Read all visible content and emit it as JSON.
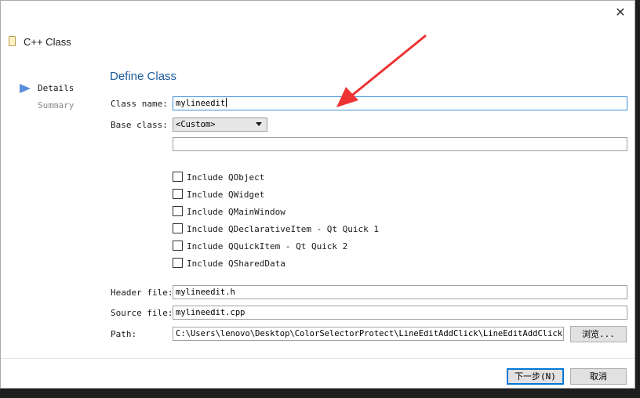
{
  "window": {
    "close_glyph": "✕"
  },
  "wizard": {
    "title": "C++ Class",
    "icon": "document-icon"
  },
  "steps": [
    {
      "label": "Details",
      "active": true
    },
    {
      "label": "Summary",
      "active": false
    }
  ],
  "page": {
    "title": "Define Class"
  },
  "form": {
    "class_name_label": "Class name:",
    "class_name_value": "mylineedit",
    "base_class_label": "Base class:",
    "base_class_value": "<Custom>",
    "custom_base_value": "",
    "checkboxes": [
      {
        "label": "Include QObject",
        "checked": false
      },
      {
        "label": "Include QWidget",
        "checked": false
      },
      {
        "label": "Include QMainWindow",
        "checked": false
      },
      {
        "label": "Include QDeclarativeItem - Qt Quick 1",
        "checked": false
      },
      {
        "label": "Include QQuickItem - Qt Quick 2",
        "checked": false
      },
      {
        "label": "Include QSharedData",
        "checked": false
      }
    ],
    "header_file_label": "Header file:",
    "header_file_value": "mylineedit.h",
    "source_file_label": "Source file:",
    "source_file_value": "mylineedit.cpp",
    "path_label": "Path:",
    "path_value": "C:\\Users\\lenovo\\Desktop\\ColorSelectorProtect\\LineEditAddClick\\LineEditAddClick",
    "browse_label": "浏览..."
  },
  "buttons": {
    "next_label": "下一步(N)",
    "cancel_label": "取消"
  },
  "colors": {
    "accent": "#1c5a9c",
    "focus_border": "#3c8ed8",
    "annotation_arrow": "#ee3333",
    "step_arrow": "#5b8fdc"
  }
}
